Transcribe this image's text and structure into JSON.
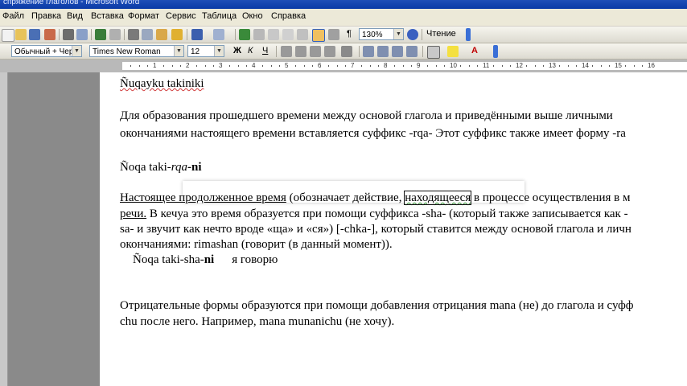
{
  "window": {
    "title": "спряжение глаголов - Microsoft Word"
  },
  "menu": [
    "Файл",
    "Правка",
    "Вид",
    "Вставка",
    "Формат",
    "Сервис",
    "Таблица",
    "Окно",
    "Справка"
  ],
  "toolbar": {
    "zoom": "130%",
    "reading_label": "Чтение",
    "style": "Обычный + Черн",
    "font": "Times New Roman",
    "size": "12"
  },
  "ruler": {
    "numbers": [
      "1",
      "2",
      "3",
      "4",
      "5",
      "6",
      "7",
      "8",
      "9",
      "10",
      "11",
      "12",
      "13",
      "14",
      "15",
      "16",
      "17"
    ]
  },
  "document": {
    "heading1": "Ñuqayku takiniki",
    "p1_line1": "Для образования прошедшего времени между основой глагола и приведёнными выше личными",
    "p1_line2": "окончаниями настоящего времени вставляется суффикс -rqa- Этот суффикс также имеет форму -ra",
    "ex1_a": "Ñoqa  taki-",
    "ex1_b": "rqa",
    "ex1_c": "-ni",
    "p2_line1_a": "Настоящее продолженное время",
    "p2_line1_b": " (обозначает действие, ",
    "p2_line1_c": "находящееся",
    "p2_line1_d": " в процессе осуществления в м",
    "p2_line2_a": "речи.",
    "p2_line2_b": " В кечуа это время образуется при помощи суффикса -sha- (который также записывается как -",
    "p2_line3": "sa- и звучит как нечто вроде «ща» и «ся») [-chka-], который ставится между основой глагола и личн",
    "p2_line4": "окончаниями: rimashan (говорит (в данный момент)).",
    "ex2_a": "Ñoqa  taki-sha-",
    "ex2_b": "ni",
    "ex2_c": "я говорю",
    "p3_line1": "Отрицательные формы образуются при помощи добавления отрицания mana (не) до глагола и суфф",
    "p3_line2": "chu после него. Например, mana munanichu (не хочу)."
  }
}
